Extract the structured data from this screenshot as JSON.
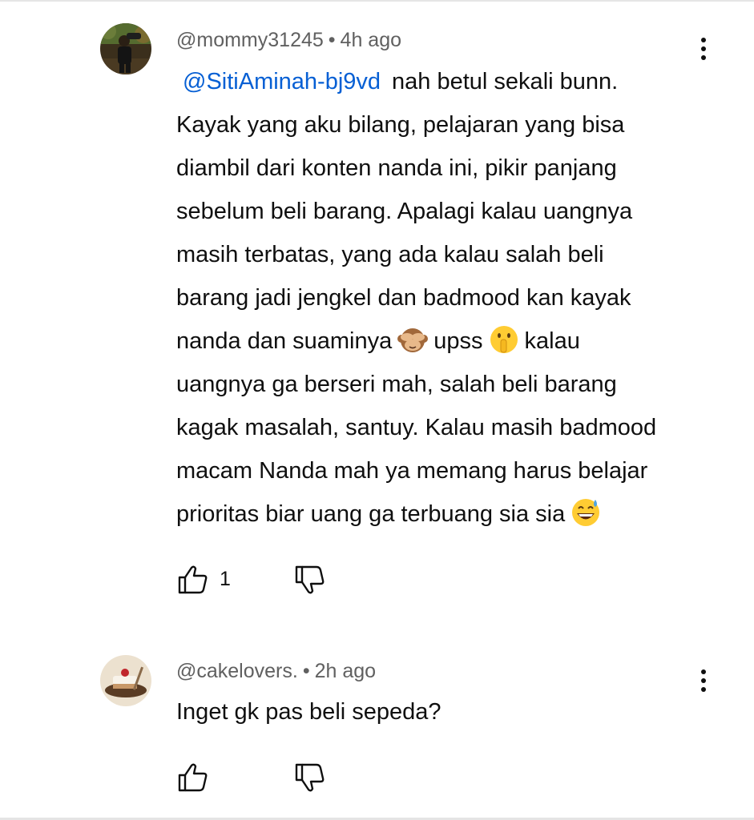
{
  "comments": [
    {
      "author": "@mommy31245",
      "separator": "•",
      "time": "4h ago",
      "mention": "@SitiAminah-bj9vd",
      "lines": [
        "nah betul sekali bunn.",
        "Kayak yang aku bilang, pelajaran yang bisa",
        "diambil dari konten nanda ini, pikir panjang",
        "sebelum beli barang. Apalagi kalau uangnya",
        "masih terbatas, yang ada kalau salah beli",
        "barang jadi jengkel dan badmood kan kayak"
      ],
      "line7_a": "nanda dan suaminya",
      "emoji_1": "see-no-evil-monkey-icon",
      "line7_b": "upss",
      "emoji_2": "shushing-face-icon",
      "line7_c": "kalau",
      "lines_after": [
        "uangnya ga berseri mah, salah beli barang",
        "kagak masalah, santuy. Kalau masih badmood",
        "macam Nanda mah ya memang harus belajar"
      ],
      "last_line": "prioritas biar uang ga terbuang sia sia",
      "emoji_3": "grinning-face-with-sweat-icon",
      "like_count": "1"
    },
    {
      "author": "@cakelovers.",
      "separator": "•",
      "time": "2h ago",
      "text": "Inget gk pas beli sepeda?",
      "like_count": ""
    }
  ],
  "colors": {
    "mention": "#065fd4",
    "meta": "#606060",
    "text": "#0f0f0f"
  }
}
